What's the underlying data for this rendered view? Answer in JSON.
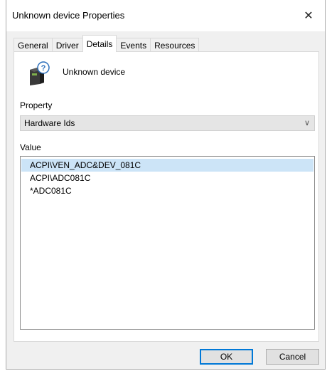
{
  "window": {
    "title": "Unknown device Properties",
    "close_glyph": "✕"
  },
  "tabs": [
    {
      "label": "General"
    },
    {
      "label": "Driver"
    },
    {
      "label": "Details"
    },
    {
      "label": "Events"
    },
    {
      "label": "Resources"
    }
  ],
  "active_tab": "Details",
  "device": {
    "name": "Unknown device",
    "icon": "unknown-device-icon"
  },
  "property": {
    "label": "Property",
    "selected": "Hardware Ids"
  },
  "value": {
    "label": "Value",
    "items": [
      {
        "text": "ACPI\\VEN_ADC&DEV_081C"
      },
      {
        "text": "ACPI\\ADC081C"
      },
      {
        "text": "*ADC081C"
      }
    ]
  },
  "buttons": {
    "ok": "OK",
    "cancel": "Cancel"
  },
  "colors": {
    "selection": "#cce4f7",
    "default_button_border": "#0078d7"
  }
}
